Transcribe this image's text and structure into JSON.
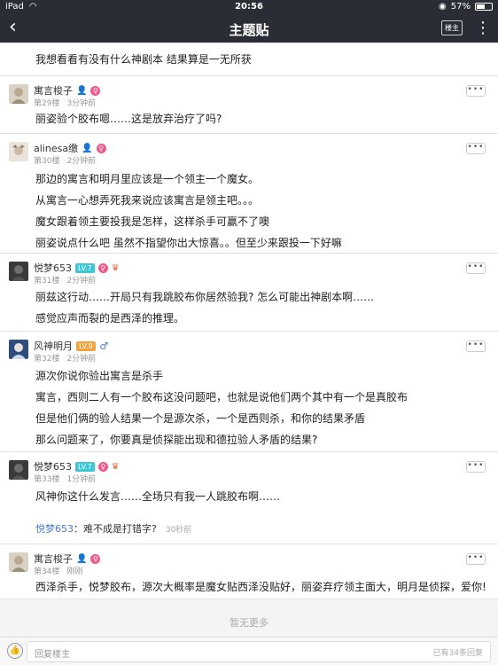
{
  "status": {
    "device": "iPad",
    "time": "20:56",
    "battery": "57%",
    "battery_level": 0.57
  },
  "nav": {
    "title": "主题贴",
    "owner_only": "楼主"
  },
  "top_line": "我想看看有没有什么神剧本 结果算是一无所获",
  "posts": [
    {
      "name": "寓言梭子",
      "floor": "第29楼",
      "time": "3分钟前",
      "lines": [
        "丽姿验个胶布嗯……这是放弃治疗了吗?"
      ]
    },
    {
      "name": "alinesa缴",
      "floor": "第30楼",
      "time": "2分钟前",
      "lines": [
        "那边的寓言和明月里应该是一个领主一个魔女。",
        "从寓言一心想弄死我来说应该寓言是领主吧。。。",
        "魔女跟着领主要投我是怎样，这样杀手可赢不了噢",
        "丽姿说点什么吧 虽然不指望你出大惊喜。。但至少来跟投一下好嘛"
      ]
    },
    {
      "name": "悦梦653",
      "floor": "第31楼",
      "time": "2分钟前",
      "level": "LV.7",
      "lines": [
        "丽兹这行动……开局只有我跳胶布你居然验我? 怎么可能出神剧本啊……",
        "感觉应声而裂的是西泽的推理。"
      ]
    },
    {
      "name": "风神明月",
      "floor": "第32楼",
      "time": "2分钟前",
      "level": "LV.9",
      "lines": [
        "源次你说你验出寓言是杀手",
        "寓言，西则二人有一个胶布这没问题吧，也就是说他们两个其中有一个是真胶布",
        "但是他们俩的验人结果一个是源次杀，一个是西则杀，和你的结果矛盾",
        "那么问题来了，你要真是侦探能出现和德拉验人矛盾的结果?"
      ]
    },
    {
      "name": "悦梦653",
      "floor": "第33楼",
      "time": "1分钟前",
      "level": "LV.7",
      "lines": [
        "风神你这什么发言……全场只有我一人跳胶布啊……"
      ],
      "reply": {
        "user": "悦梦653",
        "text": "：难不成是打错字?",
        "time": "30秒前"
      }
    },
    {
      "name": "寓言梭子",
      "floor": "第34楼",
      "time": "刚刚",
      "lines": [
        "西泽杀手，悦梦胶布，源次大概率是魔女贴西泽没贴好，丽姿弃疗领主面大，明月是侦探，爱你!"
      ]
    }
  ],
  "no_more": "暂无更多",
  "footer": {
    "placeholder": "回复楼主",
    "count": "已有34条回复"
  },
  "icons": {
    "back": "chevron-left-icon",
    "more": "vertical-dots-icon",
    "like": "thumbs-up-icon"
  }
}
